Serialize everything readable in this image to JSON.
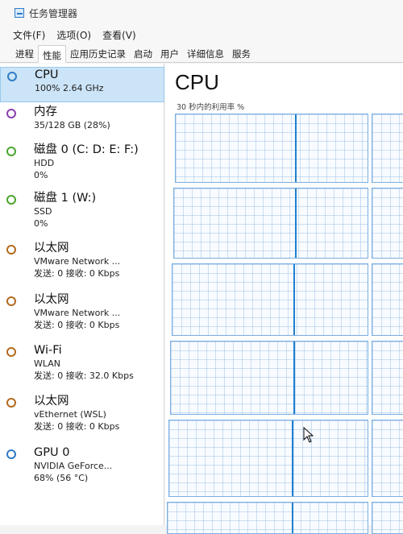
{
  "window": {
    "title": "任务管理器",
    "menu": [
      "文件(F)",
      "选项(O)",
      "查看(V)"
    ],
    "tabs": [
      "进程",
      "性能",
      "应用历史记录",
      "启动",
      "用户",
      "详细信息",
      "服务"
    ],
    "active_tab": "性能"
  },
  "sidebar": {
    "items": [
      {
        "title": "CPU",
        "line1": "100% 2.64 GHz",
        "line2": "",
        "dot_color": "#2f7bc6",
        "selected": true
      },
      {
        "title": "内存",
        "line1": "35/128 GB (28%)",
        "line2": "",
        "dot_color": "#8b3fb0",
        "selected": false
      },
      {
        "title": "磁盘 0 (C: D: E: F:)",
        "line1": "HDD",
        "line2": "0%",
        "dot_color": "#4aa52e",
        "selected": false
      },
      {
        "title": "磁盘 1 (W:)",
        "line1": "SSD",
        "line2": "0%",
        "dot_color": "#4aa52e",
        "selected": false
      },
      {
        "title": "以太网",
        "line1": "VMware Network ...",
        "line2": "发送: 0 接收: 0 Kbps",
        "dot_color": "#b56a1e",
        "selected": false
      },
      {
        "title": "以太网",
        "line1": "VMware Network ...",
        "line2": "发送: 0 接收: 0 Kbps",
        "dot_color": "#b56a1e",
        "selected": false
      },
      {
        "title": "Wi-Fi",
        "line1": "WLAN",
        "line2": "发送: 0 接收: 32.0 Kbps",
        "dot_color": "#b56a1e",
        "selected": false
      },
      {
        "title": "以太网",
        "line1": "vEthernet (WSL)",
        "line2": "发送: 0 接收: 0 Kbps",
        "dot_color": "#b56a1e",
        "selected": false
      },
      {
        "title": "GPU 0",
        "line1": "NVIDIA GeForce...",
        "line2": "68% (56 °C)",
        "dot_color": "#2f7bc6",
        "selected": false
      }
    ]
  },
  "main": {
    "title": "CPU",
    "graph_label": "30 秒内的利用率 %"
  }
}
